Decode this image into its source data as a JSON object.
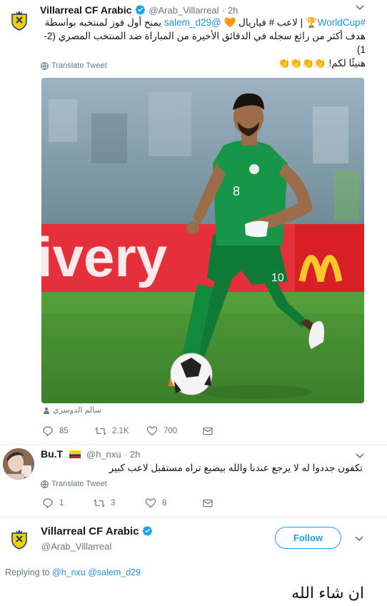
{
  "tweet1": {
    "name": "Villarreal CF Arabic",
    "handle": "@Arab_Villarreal",
    "time": "· 2h",
    "line1_hashtag": "#WorldCup",
    "line1_mid": " | لاعب # فياريال ",
    "line1_mention": "@salem_d29",
    "line1_tail": " يمنح أول فوز لمنتخبه بواسطة",
    "line2": "هدف أكثر من رائع سجله في الدقائق الأخيرة من المباراة ضد المنتخب المصري (2-1)",
    "line3": "هنيئًا لكم! 👏👏👏👏",
    "translate": "Translate Tweet",
    "image_tag": "سالم الدوسري",
    "replies": "85",
    "retweets": "2.1K",
    "likes": "700"
  },
  "tweet2": {
    "name": "Bu.T",
    "handle": "@h_nxu",
    "time": "· 2h",
    "text": "تكفون جددوا له لا يرجع عندنا والله بيضيع تراه مستقبل لاعب كبير",
    "translate": "Translate Tweet",
    "replies": "1",
    "retweets": "3",
    "likes": "8"
  },
  "focus": {
    "name": "Villarreal CF Arabic",
    "handle": "@Arab_Villarreal",
    "follow_label": "Follow",
    "replying_prefix": "Replying to ",
    "replying_to": "@h_nxu @salem_d29",
    "text": "ان شاء الله"
  },
  "image": {
    "ad_text": "ivery"
  },
  "colors": {
    "accent": "#1da1f2",
    "verified": "#1da1f2",
    "text": "#14171a",
    "muted": "#657786",
    "pitch": "#3f8a2e",
    "jersey": "#0f8a3c"
  }
}
